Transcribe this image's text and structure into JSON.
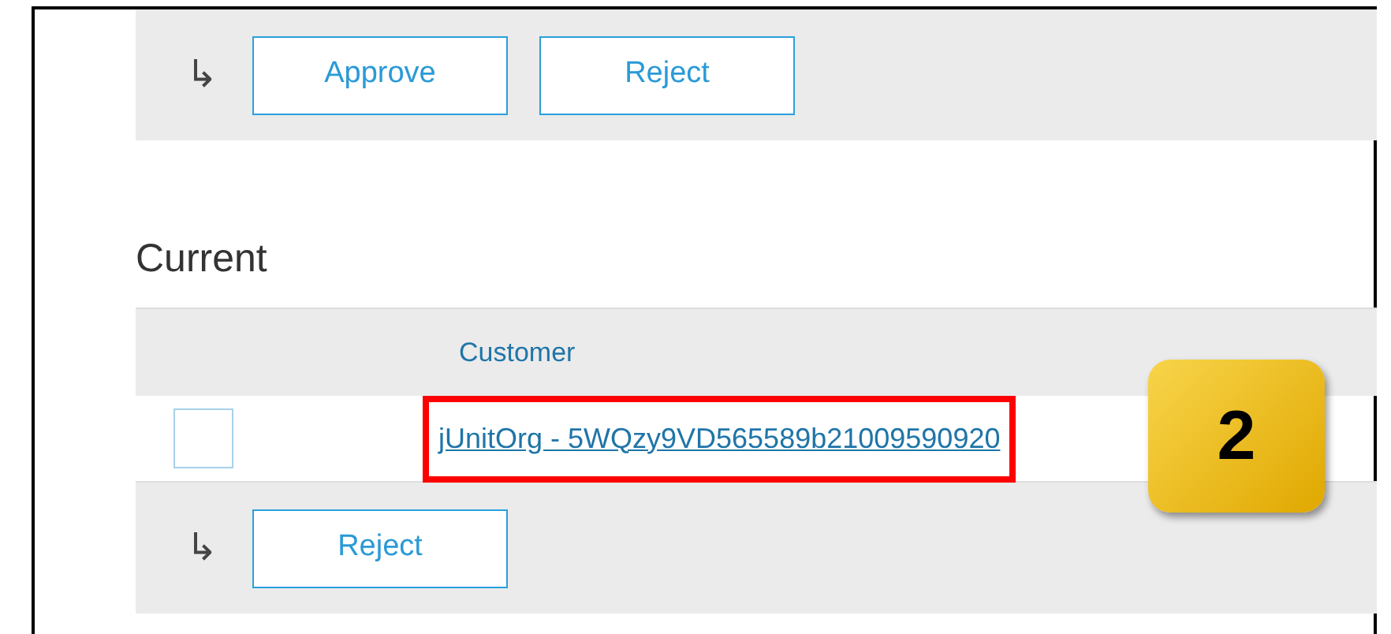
{
  "top_actions": {
    "arrow": "↳",
    "buttons": [
      "Approve",
      "Reject"
    ]
  },
  "section_title": "Current",
  "table": {
    "columns": [
      "Customer"
    ],
    "rows": [
      {
        "checked": false,
        "customer": "jUnitOrg - 5WQzy9VD565589b21009590920",
        "highlighted": true
      }
    ]
  },
  "bottom_actions": {
    "arrow": "↳",
    "buttons": [
      "Reject"
    ]
  },
  "callout": {
    "label": "2"
  }
}
